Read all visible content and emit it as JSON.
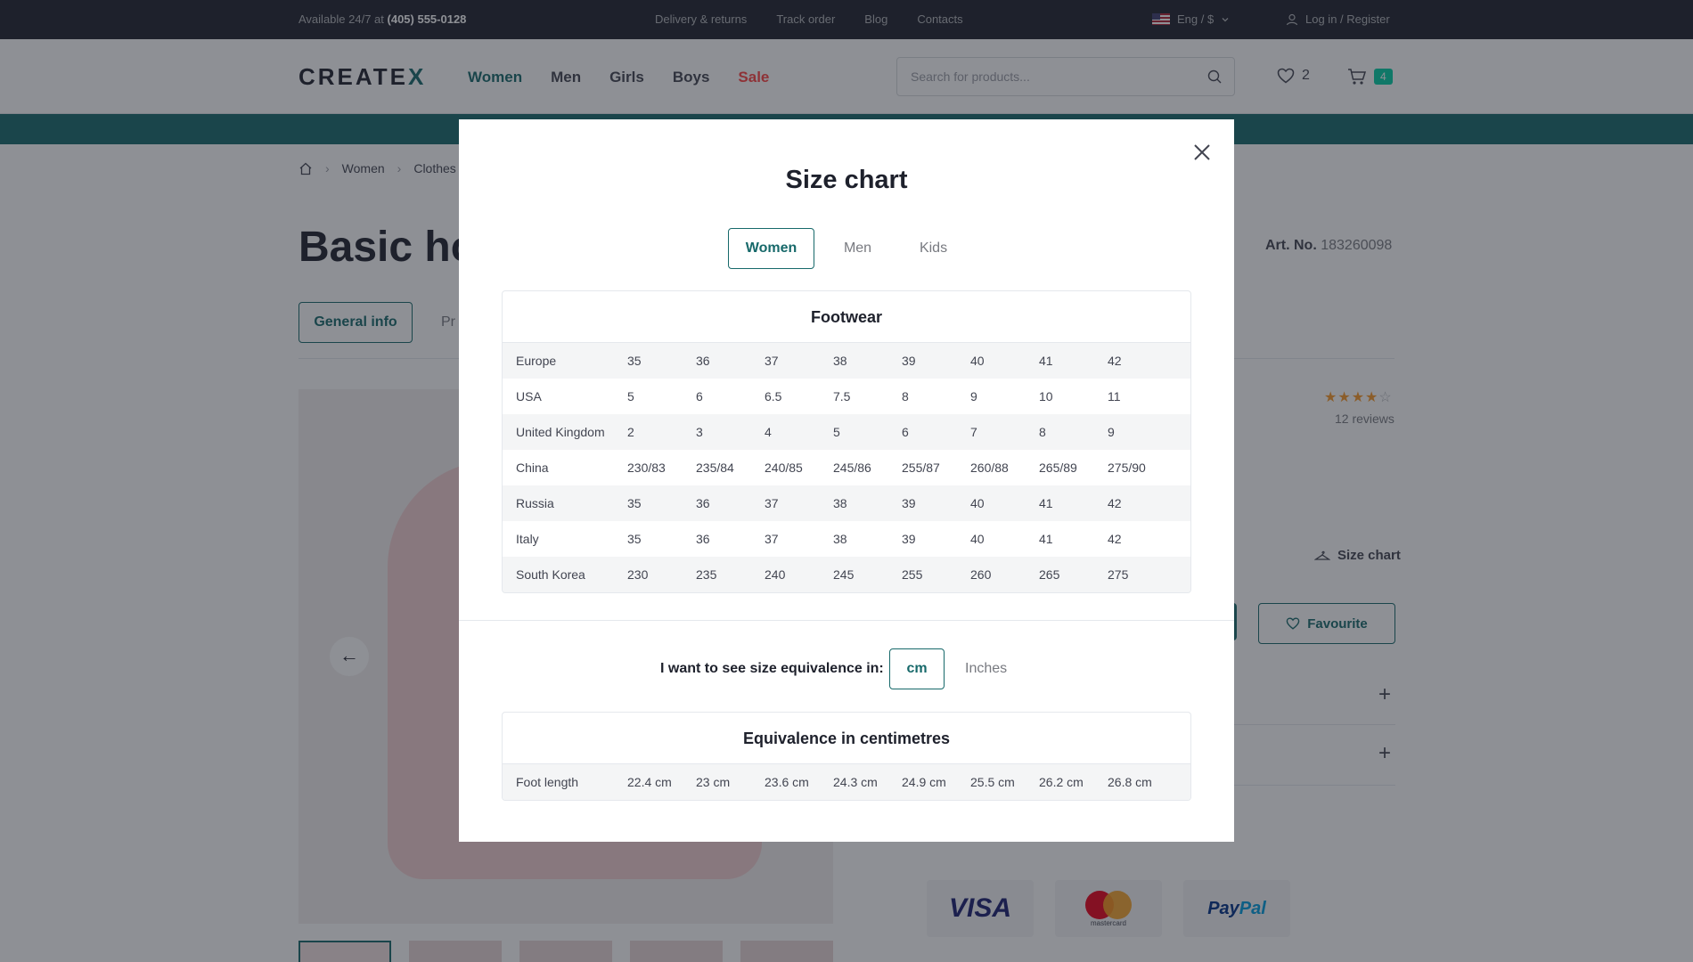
{
  "topbar": {
    "availability_prefix": "Available 24/7 at",
    "phone": "(405) 555-0128",
    "links": [
      "Delivery & returns",
      "Track order",
      "Blog",
      "Contacts"
    ],
    "language": "Eng / $",
    "login": "Log in / Register"
  },
  "header": {
    "logo_main": "CREATE",
    "logo_accent": "X",
    "nav": [
      "Women",
      "Men",
      "Girls",
      "Boys",
      "Sale"
    ],
    "search_placeholder": "Search for products...",
    "wishlist_count": "2",
    "cart_count": "4"
  },
  "breadcrumb": [
    "Women",
    "Clothes"
  ],
  "product": {
    "title": "Basic hoodie",
    "art_label": "Art. No.",
    "art_number": "183260098",
    "tab_general": "General info",
    "tab_second": "Pr",
    "rating": 4,
    "reviews": "12 reviews",
    "size_chart_link": "Size chart",
    "favourite": "Favourite"
  },
  "payments": {
    "visa": "VISA",
    "mastercard": "mastercard",
    "paypal_a": "Pay",
    "paypal_b": "Pal"
  },
  "modal": {
    "title": "Size chart",
    "tabs": [
      "Women",
      "Men",
      "Kids"
    ],
    "active_tab": "Women",
    "footwear": {
      "title": "Footwear",
      "rows": [
        {
          "label": "Europe",
          "values": [
            "35",
            "36",
            "37",
            "38",
            "39",
            "40",
            "41",
            "42"
          ]
        },
        {
          "label": "USA",
          "values": [
            "5",
            "6",
            "6.5",
            "7.5",
            "8",
            "9",
            "10",
            "11"
          ]
        },
        {
          "label": "United Kingdom",
          "values": [
            "2",
            "3",
            "4",
            "5",
            "6",
            "7",
            "8",
            "9"
          ]
        },
        {
          "label": "China",
          "values": [
            "230/83",
            "235/84",
            "240/85",
            "245/86",
            "255/87",
            "260/88",
            "265/89",
            "275/90"
          ]
        },
        {
          "label": "Russia",
          "values": [
            "35",
            "36",
            "37",
            "38",
            "39",
            "40",
            "41",
            "42"
          ]
        },
        {
          "label": "Italy",
          "values": [
            "35",
            "36",
            "37",
            "38",
            "39",
            "40",
            "41",
            "42"
          ]
        },
        {
          "label": "South Korea",
          "values": [
            "230",
            "235",
            "240",
            "245",
            "255",
            "260",
            "265",
            "275"
          ]
        }
      ]
    },
    "unit_question": "I want to see size equivalence in:",
    "units": [
      "cm",
      "Inches"
    ],
    "active_unit": "cm",
    "equivalence": {
      "title": "Equivalence in centimetres",
      "rows": [
        {
          "label": "Foot length",
          "values": [
            "22.4 cm",
            "23 cm",
            "23.6 cm",
            "24.3 cm",
            "24.9 cm",
            "25.5 cm",
            "26.2 cm",
            "26.8 cm"
          ]
        }
      ]
    }
  },
  "colors": {
    "accent": "#17696a",
    "sale": "#ff4242",
    "topbar": "#1e212c",
    "star": "#f89828"
  }
}
